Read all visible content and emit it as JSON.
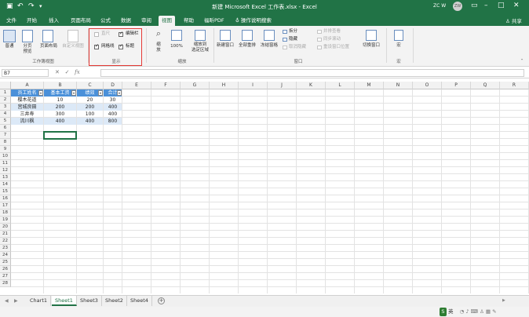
{
  "titlebar": {
    "title": "新建 Microsoft Excel 工作表.xlsx - Excel",
    "user": "ZC W",
    "avatar": "ZW"
  },
  "tabs": [
    "文件",
    "开始",
    "插入",
    "页面布局",
    "公式",
    "数据",
    "审阅",
    "视图",
    "帮助",
    "福昕PDF"
  ],
  "tell_me": "操作说明搜索",
  "share": "共享",
  "ribbon": {
    "workbook_views": {
      "normal": "普通",
      "page_break": "分页\n预览",
      "page_layout": "页面布局",
      "custom": "自定义视图",
      "label": "工作簿视图"
    },
    "show": {
      "ruler": "直尺",
      "formula_bar": "编辑栏",
      "gridlines": "网格线",
      "headings": "标题",
      "label": "显示",
      "ruler_checked": false,
      "formula_bar_checked": true,
      "gridlines_checked": true,
      "headings_checked": true
    },
    "zoom": {
      "zoom": "缩\n放",
      "zoom100": "100%",
      "zoom_selection": "缩放到\n选定区域",
      "label": "缩放"
    },
    "window": {
      "new_window": "新建窗口",
      "arrange_all": "全部重排",
      "freeze": "冻结窗格",
      "split": "拆分",
      "hide": "隐藏",
      "unhide": "取消隐藏",
      "side_by_side": "并排查看",
      "sync_scroll": "同步滚动",
      "reset_position": "重设窗口位置",
      "switch": "切换窗口",
      "label": "窗口"
    },
    "macros": {
      "macros": "宏",
      "label": "宏"
    }
  },
  "formula_bar": {
    "name_box": "B7",
    "cancel": "✕",
    "enter": "✓",
    "fx": "fx"
  },
  "columns": [
    "A",
    "B",
    "C",
    "D",
    "E",
    "F",
    "G",
    "H",
    "I",
    "J",
    "K",
    "L",
    "M",
    "N",
    "O",
    "P",
    "Q",
    "R"
  ],
  "rows": [
    "1",
    "2",
    "3",
    "4",
    "5",
    "6",
    "7",
    "8",
    "9",
    "10",
    "11",
    "12",
    "13",
    "14",
    "15",
    "16",
    "17",
    "18",
    "19",
    "20",
    "21",
    "22",
    "23",
    "24",
    "25",
    "26",
    "27",
    "28"
  ],
  "table": {
    "headers": [
      "员工姓名",
      "基本工资",
      "绩效",
      "合计"
    ],
    "rows": [
      [
        "樱木花道",
        "10",
        "20",
        "30"
      ],
      [
        "宫城良田",
        "200",
        "200",
        "400"
      ],
      [
        "三井寿",
        "300",
        "100",
        "400"
      ],
      [
        "流川枫",
        "400",
        "400",
        "800"
      ]
    ]
  },
  "sheets": [
    "Chart1",
    "Sheet1",
    "Sheet3",
    "Sheet2",
    "Sheet4"
  ],
  "active_sheet": "Sheet1",
  "statusbar": {
    "ime": "英"
  },
  "colors": {
    "accent": "#217346",
    "table_header": "#4a90d9",
    "table_band": "#dce9f7",
    "highlight": "#e53935"
  }
}
